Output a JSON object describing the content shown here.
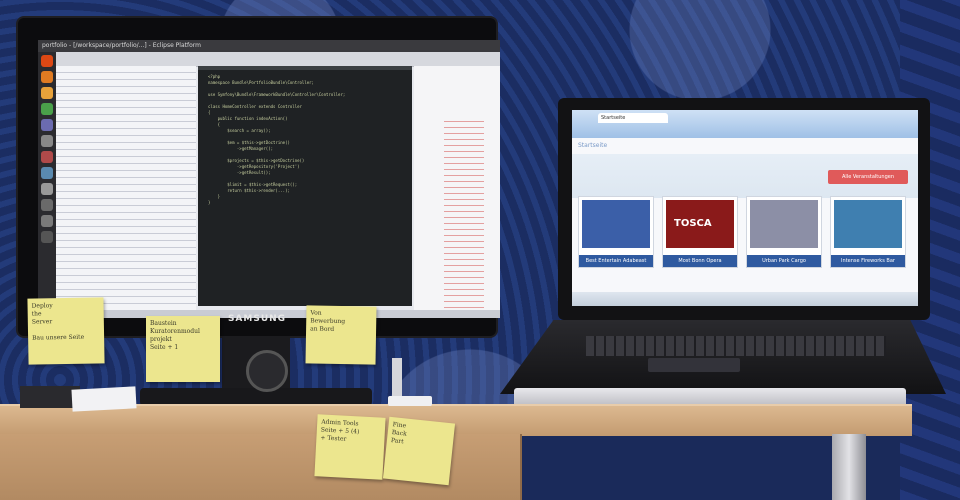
{
  "monitor": {
    "brand": "SAMSUNG",
    "window_title": "portfolio - [/workspace/portfolio/...] - Eclipse Platform",
    "code_lines": [
      "<?php",
      "namespace Bundle\\PortfolioBundle\\Controller;",
      "",
      "use Symfony\\Bundle\\FrameworkBundle\\Controller\\Controller;",
      "",
      "class HomeController extends Controller",
      "{",
      "    public function indexAction()",
      "    {",
      "        $search = array();",
      "",
      "        $em = $this->getDoctrine()",
      "            ->getManager();",
      "",
      "        $projects = $this->getDoctrine()",
      "            ->getRepository('Project')",
      "            ->getResult();",
      "",
      "        $limit = $this->getRequest();",
      "        return $this->render(...);",
      "    }",
      "}"
    ]
  },
  "laptop": {
    "browser_tab": "Startseite",
    "page_header": "Startseite",
    "cta_label": "Alle Veranstaltungen",
    "thumbnails": [
      {
        "caption": "Best Entertain Adabeast",
        "color": "#3b5fa8"
      },
      {
        "caption": "Most Bonn Opera",
        "color": "#8a1a1a",
        "word": "TOSCA"
      },
      {
        "caption": "Urban Park Cargo",
        "color": "#8c8fa6"
      },
      {
        "caption": "Intense Fireworks Bar",
        "color": "#3f7fb0"
      }
    ]
  },
  "notes": [
    {
      "id": "note-1",
      "lines": [
        "Deploy",
        "the",
        "Server",
        "",
        "Bau unsere Seite"
      ]
    },
    {
      "id": "note-2",
      "lines": [
        "Baustein",
        "Kuratorenmodul",
        "projekt",
        "Seite + 1"
      ]
    },
    {
      "id": "note-3",
      "lines": [
        "Von",
        "Bewerbung",
        "an Bord"
      ]
    },
    {
      "id": "note-4",
      "lines": [
        "Admin Tools",
        "Seite + 5 (4)",
        "+ Tester"
      ]
    },
    {
      "id": "note-5",
      "lines": [
        "Fine",
        "Back",
        "Part"
      ]
    }
  ]
}
